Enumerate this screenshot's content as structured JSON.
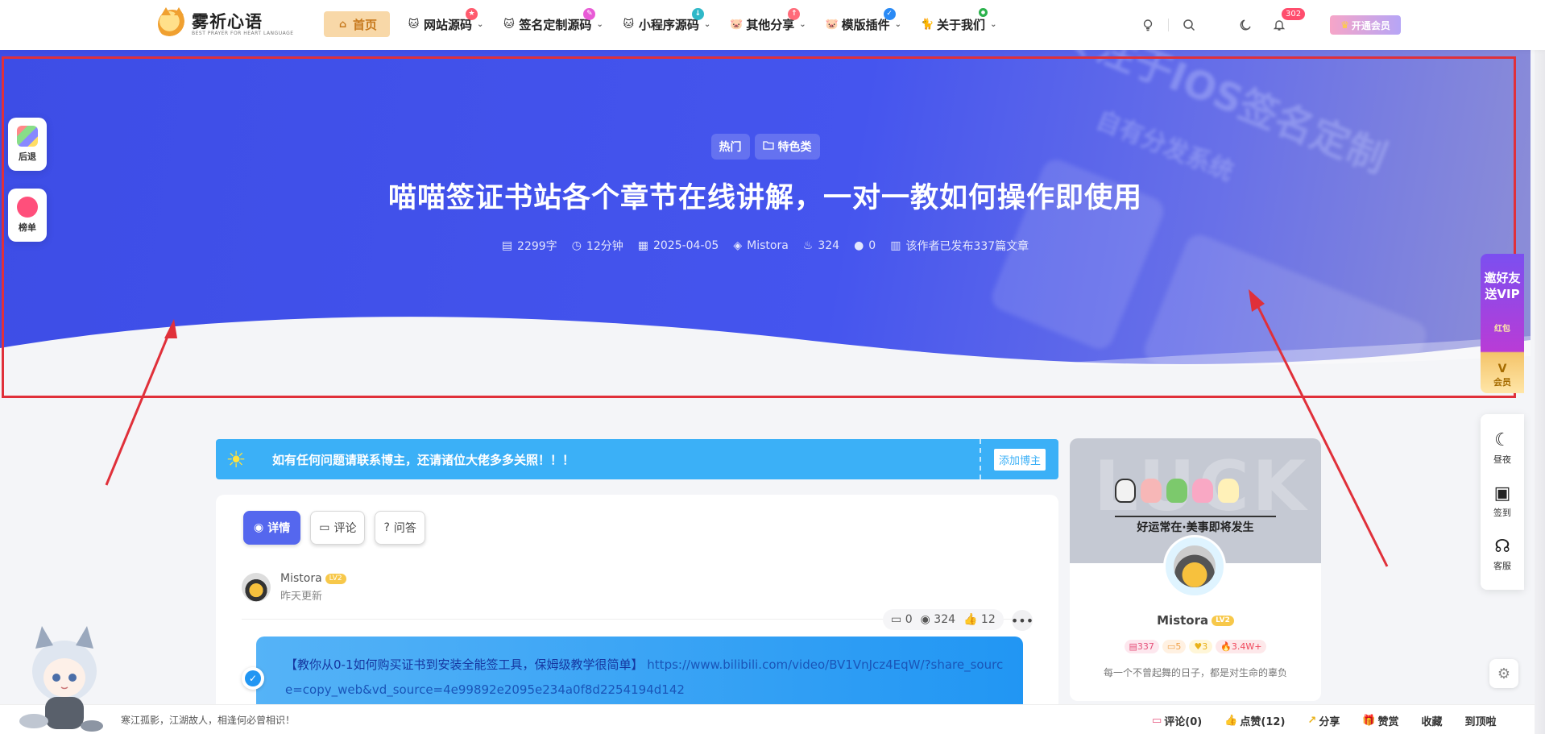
{
  "site": {
    "logo_title": "雾祈心语",
    "logo_sub": "BEST PRAYER FOR HEART LANGUAGE"
  },
  "nav": {
    "items": [
      {
        "label": "首页",
        "icon": "home-icon",
        "active": true
      },
      {
        "label": "网站源码",
        "icon": "cat-icon",
        "badge_color": "#ff5b6e",
        "badge": "★"
      },
      {
        "label": "签名定制源码",
        "icon": "cat-icon",
        "badge_color": "#e85bd6",
        "badge": "✎"
      },
      {
        "label": "小程序源码",
        "icon": "cat-icon",
        "badge_color": "#2fb8c8",
        "badge": "↓"
      },
      {
        "label": "其他分享",
        "icon": "pig-icon",
        "badge_color": "#ff6b7a",
        "badge": "↑"
      },
      {
        "label": "模版插件",
        "icon": "pig-icon",
        "badge_color": "#2a8af5",
        "badge": "✓"
      },
      {
        "label": "关于我们",
        "icon": "cat-black-icon",
        "badge_color": "#2bb24c",
        "badge": "●"
      }
    ],
    "notification_count": "302",
    "vip_label": "开通会员"
  },
  "hero": {
    "tags": [
      {
        "label": "热门"
      },
      {
        "label": "特色类",
        "icon": "folder-icon"
      }
    ],
    "title": "喵喵签证书站各个章节在线讲解，一对一教如何操作即使用",
    "meta": {
      "words": "2299字",
      "read_time": "12分钟",
      "date": "2025-04-05",
      "author": "Mistora",
      "views": "324",
      "comments": "0",
      "author_posts": "该作者已发布337篇文章"
    },
    "bg_text_1": "专注于IOS签名定制",
    "bg_text_2": "自有分发系统"
  },
  "left_float": [
    {
      "label": "后退",
      "icon": "apps-icon"
    },
    {
      "label": "榜单",
      "icon": "ranking-icon"
    }
  ],
  "right_float": {
    "promo_line1": "邀好友",
    "promo_line2": "送VIP",
    "promo_sub": "红包",
    "vip_label": "会员",
    "items": [
      {
        "label": "昼夜",
        "icon": "moon-icon"
      },
      {
        "label": "签到",
        "icon": "calendar-icon"
      },
      {
        "label": "客服",
        "icon": "headset-icon"
      }
    ]
  },
  "notice": {
    "text": "如有任何问题请联系博主，还请诸位大佬多多关照！！！",
    "button": "添加博主"
  },
  "article": {
    "tabs": [
      {
        "label": "详情",
        "icon": "eye-icon",
        "active": true
      },
      {
        "label": "评论",
        "icon": "comment-icon"
      },
      {
        "label": "问答",
        "icon": "question-icon"
      }
    ],
    "author_name": "Mistora",
    "author_level": "LV2",
    "updated": "昨天更新",
    "stats": {
      "comments": "0",
      "views": "324",
      "likes": "12"
    },
    "note_title": "【教你从0-1如何购买证书到安装全能签工具，保姆级教学很简单】",
    "note_link": "https://www.bilibili.com/video/BV1VnJcz4EqW/?share_source=copy_web&vd_source=4e99892e2095e234a0f8d2254194d142"
  },
  "sidebar": {
    "banner_bg": "LUCK",
    "banner_text": "好运常在·美事即将发生",
    "name": "Mistora",
    "level": "LV2",
    "stats": [
      {
        "value": "337",
        "icon": "doc-icon",
        "color": "#e5507a",
        "bg": "#fde7ee"
      },
      {
        "value": "5",
        "icon": "comment-icon",
        "color": "#f0a14a",
        "bg": "#fff1e2"
      },
      {
        "value": "3",
        "icon": "heart-icon",
        "color": "#e9b21a",
        "bg": "#fff6d8"
      },
      {
        "value": "3.4W+",
        "icon": "fire-icon",
        "color": "#f0475b",
        "bg": "#fde8ea"
      }
    ],
    "motto": "每一个不曾起舞的日子，都是对生命的辜负"
  },
  "footer": {
    "quote": "寒江孤影，江湖故人，相逢何必曾相识！",
    "actions": [
      {
        "label": "评论(0)",
        "icon": "comment-icon"
      },
      {
        "label": "点赞(12)",
        "icon": "thumb-icon"
      },
      {
        "label": "分享",
        "icon": "share-icon"
      },
      {
        "label": "赞赏",
        "icon": "gift-icon"
      },
      {
        "label": "收藏",
        "icon": "star-icon"
      },
      {
        "label": "到顶啦",
        "icon": "top-icon"
      }
    ]
  }
}
